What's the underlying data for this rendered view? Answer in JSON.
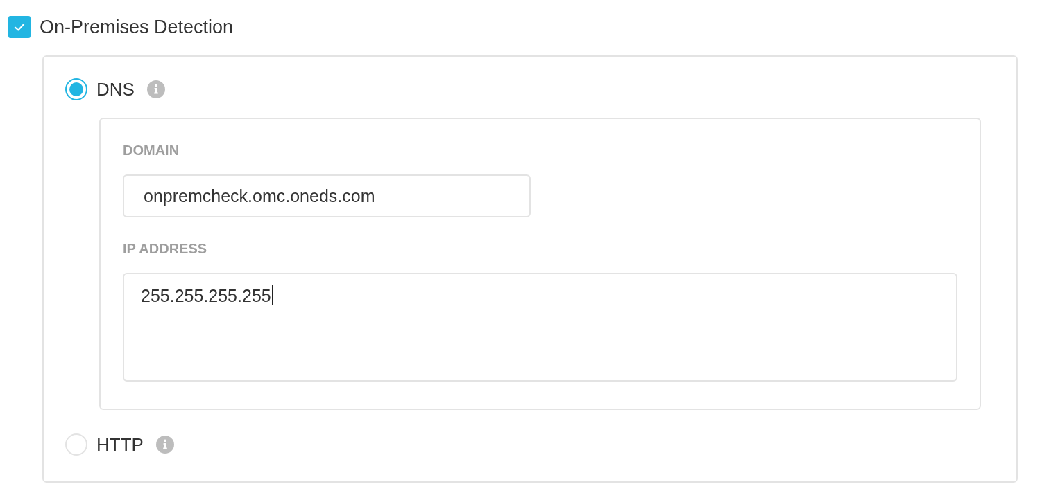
{
  "detection": {
    "label": "On-Premises Detection",
    "checked": true
  },
  "methods": [
    {
      "label": "DNS",
      "selected": true,
      "fields": [
        {
          "label": "DOMAIN",
          "kind": "input",
          "value": "onpremcheck.omc.oneds.com",
          "focused": false
        },
        {
          "label": "IP ADDRESS",
          "kind": "textarea",
          "value": "255.255.255.255",
          "focused": true
        }
      ]
    },
    {
      "label": "HTTP",
      "selected": false
    }
  ]
}
